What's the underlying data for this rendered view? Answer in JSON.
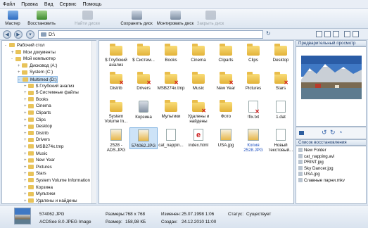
{
  "menu": [
    "Файл",
    "Правка",
    "Вид",
    "Сервис",
    "Помощь"
  ],
  "toolbar": {
    "wizard": "Мастер",
    "restore": "Восстановить",
    "find_disks": "Найти диски",
    "save_disk": "Сохранить диск",
    "mount_disk": "Монтировать диск",
    "close_disk": "Закрыть диск"
  },
  "address": {
    "path": "D:\\"
  },
  "tree": [
    {
      "label": "Рабочий стол",
      "level": 0,
      "exp": "-"
    },
    {
      "label": "Мои документы",
      "level": 1,
      "exp": "+"
    },
    {
      "label": "Мой компьютер",
      "level": 1,
      "exp": "-"
    },
    {
      "label": "Дисковод (A:)",
      "level": 2,
      "exp": "+"
    },
    {
      "label": "System (C:)",
      "level": 2,
      "exp": "+"
    },
    {
      "label": "Multimed (D:)",
      "level": 2,
      "exp": "-",
      "selected": true
    },
    {
      "label": "$ Глубокий анализ",
      "level": 3,
      "exp": "+"
    },
    {
      "label": "$ Системные файлы",
      "level": 3,
      "exp": "+"
    },
    {
      "label": "Books",
      "level": 3,
      "exp": "+"
    },
    {
      "label": "Cinema",
      "level": 3,
      "exp": "+"
    },
    {
      "label": "Cliparts",
      "level": 3,
      "exp": "+"
    },
    {
      "label": "Clips",
      "level": 3,
      "exp": "+"
    },
    {
      "label": "Desktop",
      "level": 3,
      "exp": "+"
    },
    {
      "label": "Distrib",
      "level": 3,
      "exp": "+"
    },
    {
      "label": "Drivers",
      "level": 3,
      "exp": "+"
    },
    {
      "label": "MSB274x.tmp",
      "level": 3,
      "exp": "+"
    },
    {
      "label": "Music",
      "level": 3,
      "exp": "+"
    },
    {
      "label": "New Year",
      "level": 3,
      "exp": "+"
    },
    {
      "label": "Pictures",
      "level": 3,
      "exp": "+"
    },
    {
      "label": "Stars",
      "level": 3,
      "exp": "+"
    },
    {
      "label": "System Volume Information",
      "level": 3,
      "exp": "+"
    },
    {
      "label": "Корзина",
      "level": 3,
      "exp": "+"
    },
    {
      "label": "Мультики",
      "level": 3,
      "exp": "+"
    },
    {
      "label": "Удалены и найдены",
      "level": 3,
      "exp": "+"
    }
  ],
  "files": [
    {
      "name": "$ Глубокий анализ",
      "kind": "folder"
    },
    {
      "name": "$ Систем...",
      "kind": "folder"
    },
    {
      "name": "Books",
      "kind": "folder"
    },
    {
      "name": "Cinema",
      "kind": "folder"
    },
    {
      "name": "Cliparts",
      "kind": "folder"
    },
    {
      "name": "Clips",
      "kind": "folder"
    },
    {
      "name": "Desktop",
      "kind": "folder"
    },
    {
      "name": "Distrib",
      "kind": "folder",
      "deleted": true
    },
    {
      "name": "Drivers",
      "kind": "folder",
      "deleted": true
    },
    {
      "name": "MSB274x.tmp",
      "kind": "folder",
      "deleted": true
    },
    {
      "name": "Music",
      "kind": "folder"
    },
    {
      "name": "New Year",
      "kind": "folder",
      "deleted": true
    },
    {
      "name": "Pictures",
      "kind": "folder"
    },
    {
      "name": "Stars",
      "kind": "folder",
      "deleted": true
    },
    {
      "name": "System Volume In...",
      "kind": "folder"
    },
    {
      "name": "Корзина",
      "kind": "recycle"
    },
    {
      "name": "Мультики",
      "kind": "folder"
    },
    {
      "name": "Удалены и найдены",
      "kind": "folder",
      "deleted": true
    },
    {
      "name": "Фото",
      "kind": "folder"
    },
    {
      "name": "!fix.txt",
      "kind": "file",
      "deleted": true
    },
    {
      "name": "1.dat",
      "kind": "file"
    },
    {
      "name": "2528 - ADS.JPG",
      "kind": "jpg"
    },
    {
      "name": "574062.JPG",
      "kind": "jpg",
      "selected": true
    },
    {
      "name": "cat_nappin...",
      "kind": "file"
    },
    {
      "name": "index.html",
      "kind": "html"
    },
    {
      "name": "USA.jpg",
      "kind": "jpg"
    },
    {
      "name": "Копия 2528.JPG",
      "kind": "jpg",
      "blue": true
    },
    {
      "name": "Новый текстовый...",
      "kind": "file"
    }
  ],
  "preview": {
    "title": "Предварительный просмотр"
  },
  "recovery": {
    "title": "Список восстановления",
    "items": [
      "New Folder",
      "cat_napping.avi",
      "PRINT.jpg",
      "Sky Dancer.jpg",
      "USA.jpg",
      "Славные парни.mkv"
    ]
  },
  "status": {
    "name": "574062.JPG",
    "type": "ACDSee 8.0 JPEG Image",
    "size_label": "Размеры:",
    "size_val": "768 x 768",
    "filesize_label": "Размер:",
    "filesize_val": "158,98 КБ",
    "modified_label": "Изменен:",
    "modified_val": "25.07.1998 1:06",
    "created_label": "Создан:",
    "created_val": "24.12.2010 11:00",
    "status_label": "Статус:",
    "status_val": "Существует"
  },
  "colors": {
    "accent": "#cde3f7",
    "deleted": "#d21c1c",
    "folder": "#e8c35a"
  }
}
